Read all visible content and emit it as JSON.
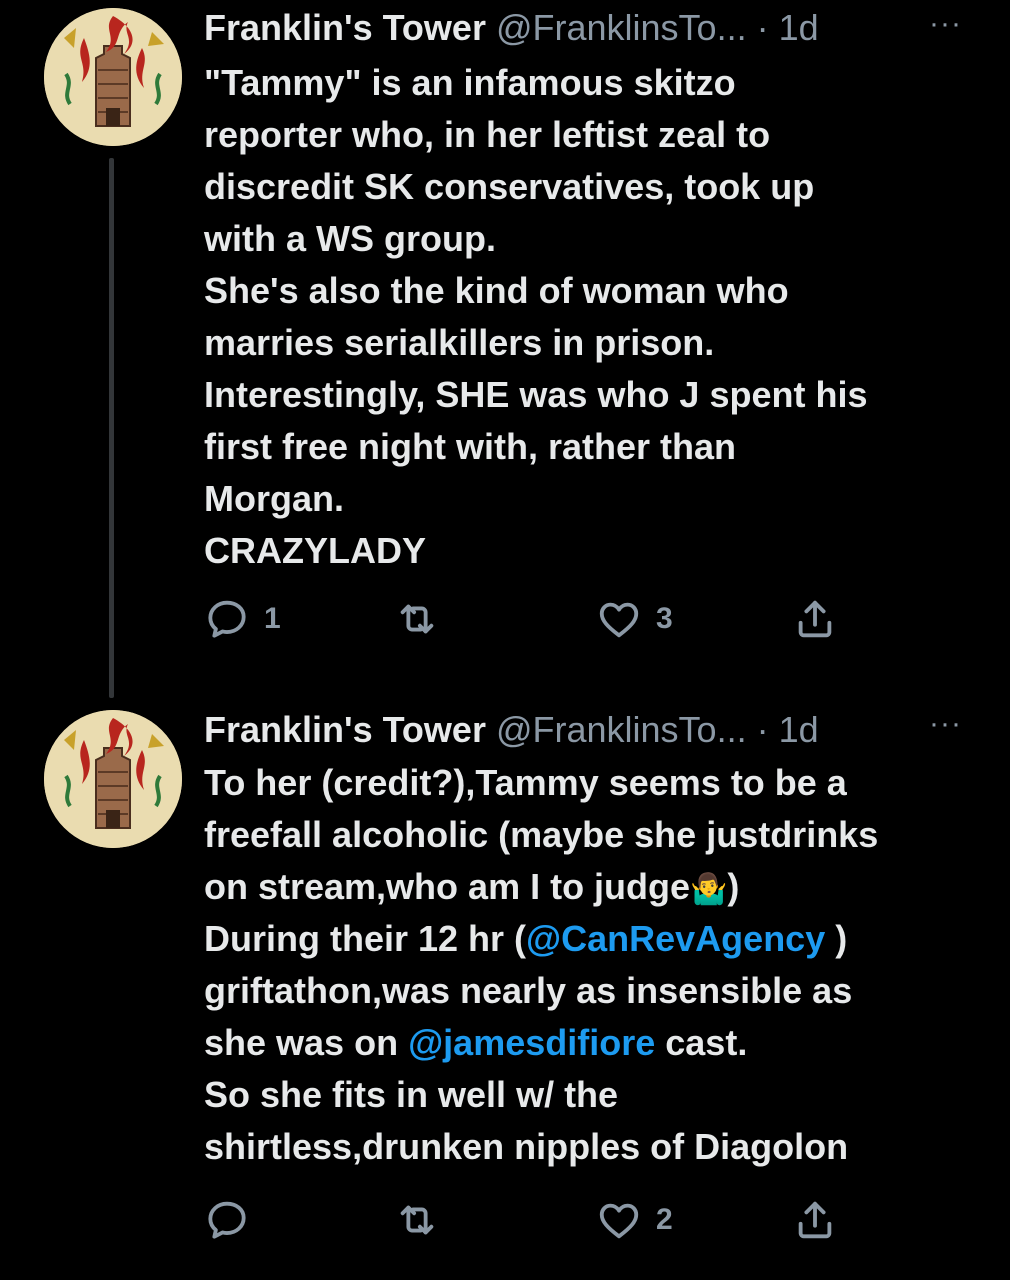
{
  "tweets": [
    {
      "author": {
        "name": "Franklin's Tower",
        "handle": "@FranklinsTo...",
        "separator": "·",
        "time": "1d"
      },
      "more_label": "···",
      "lines": [
        [
          {
            "t": "\"Tammy\" is  an infamous  skitzo"
          }
        ],
        [
          {
            "t": "reporter who, in her leftist zeal to"
          }
        ],
        [
          {
            "t": "discredit SK conservatives, took up"
          }
        ],
        [
          {
            "t": "with a WS group."
          }
        ],
        [
          {
            "t": "She's also the kind of woman who"
          }
        ],
        [
          {
            "t": "marries serialkillers in prison."
          }
        ],
        [
          {
            "t": "Interestingly, SHE was who J spent his"
          }
        ],
        [
          {
            "t": "first free night with, rather than"
          }
        ],
        [
          {
            "t": "Morgan."
          }
        ],
        [
          {
            "t": "CRAZYLADY"
          }
        ]
      ],
      "stats": {
        "replies": "1",
        "retweets": "",
        "likes": "3"
      }
    },
    {
      "author": {
        "name": "Franklin's Tower",
        "handle": "@FranklinsTo...",
        "separator": "·",
        "time": "1d"
      },
      "more_label": "···",
      "lines": [
        [
          {
            "t": "To her (credit?),Tammy seems to be a"
          }
        ],
        [
          {
            "t": "freefall alcoholic (maybe she justdrinks"
          }
        ],
        [
          {
            "t": "on stream,who am I to judge"
          },
          {
            "t": "🤷‍♂️",
            "emoji": true
          },
          {
            "t": ")"
          }
        ],
        [
          {
            "t": "During their 12 hr ("
          },
          {
            "t": "@CanRevAgency",
            "mention": true
          },
          {
            "t": " )"
          }
        ],
        [
          {
            "t": "griftathon,was nearly as insensible as"
          }
        ],
        [
          {
            "t": "she was on "
          },
          {
            "t": "@jamesdifiore",
            "mention": true
          },
          {
            "t": " cast."
          }
        ],
        [
          {
            "t": "So she fits in well w/ the"
          }
        ],
        [
          {
            "t": "shirtless,drunken nipples of Diagolon"
          }
        ]
      ],
      "stats": {
        "replies": "",
        "retweets": "",
        "likes": "2"
      }
    }
  ],
  "icons": {
    "reply": "speech-bubble-icon",
    "retweet": "retweet-arrows-icon",
    "like": "heart-icon",
    "share": "share-upload-icon",
    "avatar": "burning-tower-avatar"
  },
  "colors": {
    "background": "#000000",
    "text": "#e7e9ea",
    "muted": "#8b98a5",
    "link": "#1d9bf0",
    "thread_line": "#333639"
  }
}
